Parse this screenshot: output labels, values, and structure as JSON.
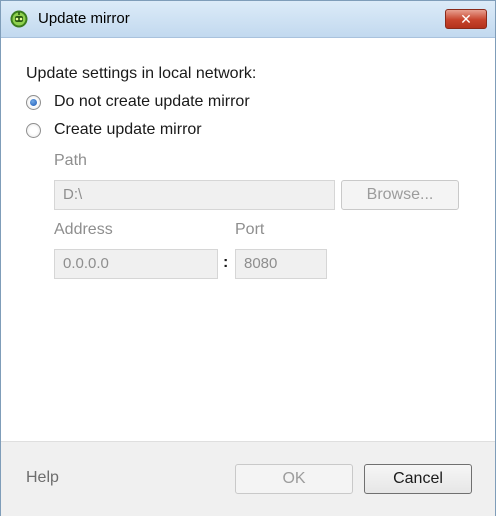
{
  "window": {
    "title": "Update mirror",
    "close_symbol": "✕",
    "app_icon": "eset-robot-icon"
  },
  "main": {
    "heading": "Update settings in local network:",
    "options": [
      {
        "label": "Do not create update mirror",
        "checked": true
      },
      {
        "label": "Create update mirror",
        "checked": false
      }
    ],
    "path_label": "Path",
    "path_value": "D:\\",
    "browse_label": "Browse...",
    "address_label": "Address",
    "address_value": "0.0.0.0",
    "port_label": "Port",
    "port_value": "8080",
    "separator": ":"
  },
  "footer": {
    "help_label": "Help",
    "ok_label": "OK",
    "cancel_label": "Cancel"
  },
  "colors": {
    "titlebar": "#c2d9ef",
    "close": "#c7432c",
    "disabled_text": "#8e8e8e"
  }
}
